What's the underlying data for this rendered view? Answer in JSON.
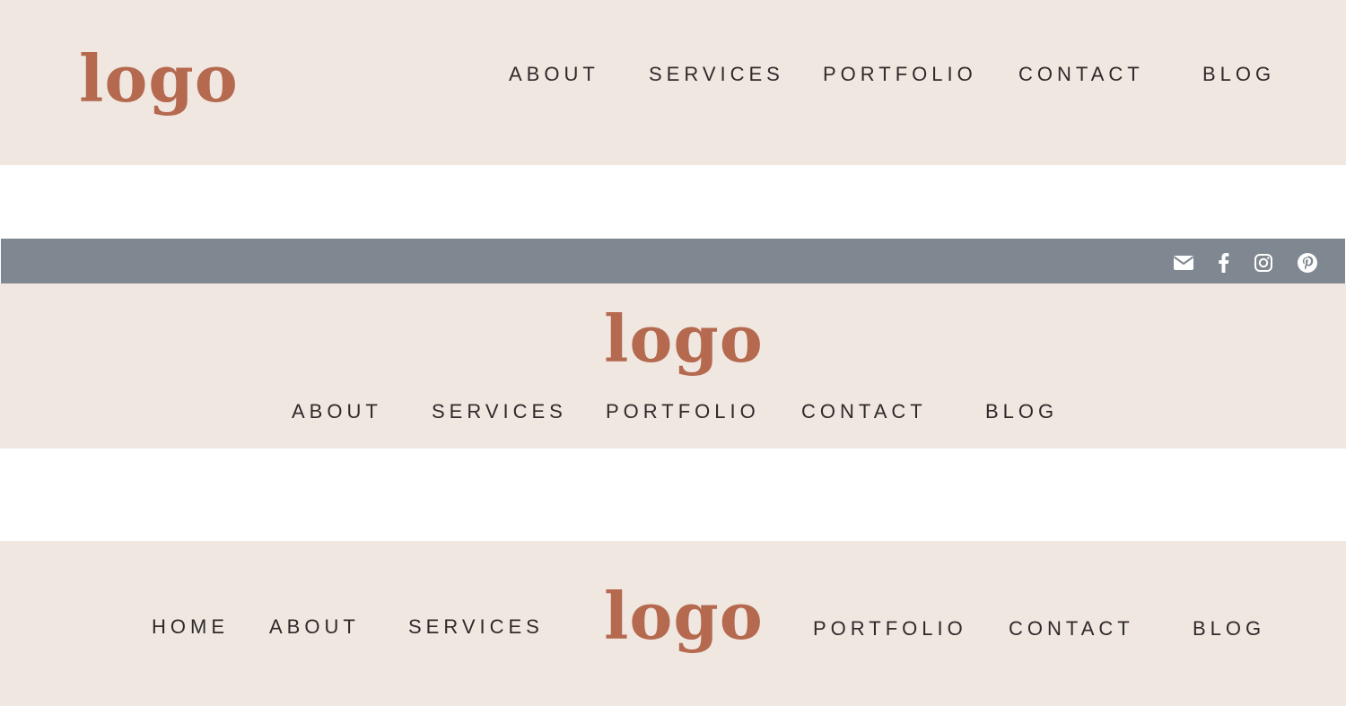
{
  "colors": {
    "band_background": "#f0e7e1",
    "logo": "#b5694f",
    "nav_text": "#2e2a29",
    "topbar": "#7f8790",
    "social_icon": "#ffffff"
  },
  "header1": {
    "logo": "logo",
    "nav": [
      "ABOUT",
      "SERVICES",
      "PORTFOLIO",
      "CONTACT",
      "BLOG"
    ]
  },
  "header2": {
    "social_icons": [
      "envelope-icon",
      "facebook-icon",
      "instagram-icon",
      "pinterest-icon"
    ],
    "logo": "logo",
    "nav": [
      "ABOUT",
      "SERVICES",
      "PORTFOLIO",
      "CONTACT",
      "BLOG"
    ]
  },
  "header3": {
    "logo": "logo",
    "nav_left": [
      "HOME",
      "ABOUT",
      "SERVICES"
    ],
    "nav_right": [
      "PORTFOLIO",
      "CONTACT",
      "BLOG"
    ]
  }
}
